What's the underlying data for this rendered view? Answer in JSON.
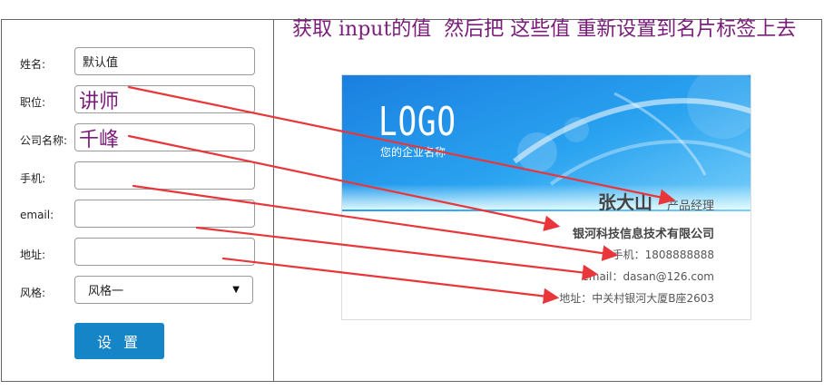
{
  "form": {
    "name_label": "姓名:",
    "name_value": "默认值",
    "position_label": "职位:",
    "position_value": "讲师",
    "company_label": "公司名称:",
    "company_value": "千峰",
    "phone_label": "手机:",
    "phone_value": "",
    "email_label": "email:",
    "email_value": "",
    "address_label": "地址:",
    "address_value": "",
    "style_label": "风格:",
    "style_value": "风格一",
    "submit_label": "设 置"
  },
  "note": "获取 input的值  然后把 这些值 重新设置到名片标签上去",
  "card": {
    "logo": "LOGO",
    "slogan": "您的企业名称",
    "name": "张大山",
    "position": "产品经理",
    "company": "银河科技信息技术有限公司",
    "phone": "手机：1808888888",
    "email": "email：dasan@126.com",
    "address": "地址：中关村银河大厦B座2603"
  },
  "colors": {
    "accent": "#1585c8",
    "annotation": "#7a1d7a",
    "arrow": "#e8363a"
  }
}
